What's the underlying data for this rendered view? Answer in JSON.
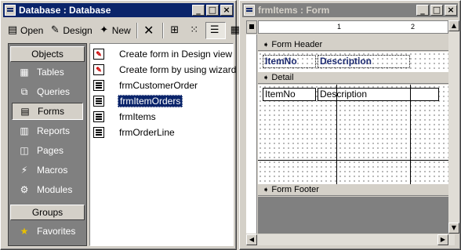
{
  "db_window": {
    "title": "Database : Database",
    "toolbar": {
      "open_label": "Open",
      "design_label": "Design",
      "new_label": "New"
    },
    "objects_header": "Objects",
    "objects": [
      {
        "label": "Tables",
        "icon": "table-icon"
      },
      {
        "label": "Queries",
        "icon": "query-icon"
      },
      {
        "label": "Forms",
        "icon": "form-icon",
        "selected": true
      },
      {
        "label": "Reports",
        "icon": "report-icon"
      },
      {
        "label": "Pages",
        "icon": "page-icon"
      },
      {
        "label": "Macros",
        "icon": "macro-icon"
      },
      {
        "label": "Modules",
        "icon": "module-icon"
      }
    ],
    "groups_header": "Groups",
    "groups": [
      {
        "label": "Favorites",
        "icon": "favorites-icon"
      }
    ],
    "list_items": [
      {
        "label": "Create form in Design view",
        "kind": "wizard"
      },
      {
        "label": "Create form by using wizard",
        "kind": "wizard"
      },
      {
        "label": "frmCustomerOrder",
        "kind": "form"
      },
      {
        "label": "frmItemOrders",
        "kind": "form",
        "selected": true
      },
      {
        "label": "frmItems",
        "kind": "form"
      },
      {
        "label": "frmOrderLine",
        "kind": "form"
      }
    ]
  },
  "form_window": {
    "title": "frmItems : Form",
    "ruler_marks": [
      "1",
      "2"
    ],
    "sections": {
      "header": "Form Header",
      "detail": "Detail",
      "footer": "Form Footer"
    },
    "header_labels": [
      "ItemNo",
      "Description"
    ],
    "detail_fields": [
      "ItemNo",
      "Description"
    ]
  },
  "colors": {
    "active_title": "#0a246a",
    "inactive_title": "#808080",
    "face": "#d4d0c8"
  }
}
